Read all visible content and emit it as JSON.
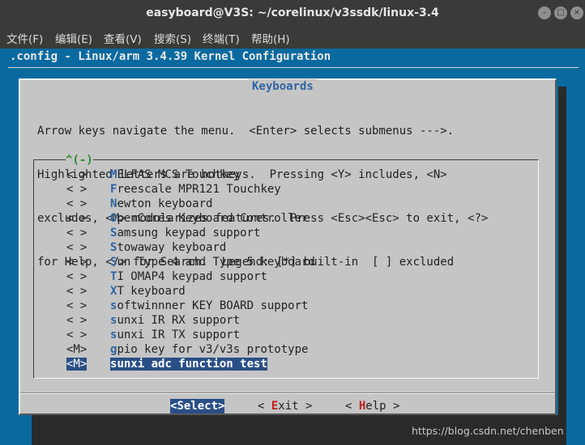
{
  "window": {
    "title": "easyboard@V3S: ~/corelinux/v3ssdk/linux-3.4",
    "buttons": {
      "minimize": "–",
      "maximize": "□",
      "close": "×"
    }
  },
  "menubar": [
    "文件(F)",
    "编辑(E)",
    "查看(V)",
    "搜索(S)",
    "终端(T)",
    "帮助(H)"
  ],
  "terminal": {
    "header": ".config - Linux/arm 3.4.39 Kernel Configuration",
    "dialog": {
      "title": "Keyboards",
      "help_lines": [
        "Arrow keys navigate the menu.  <Enter> selects submenus --->.",
        "Highlighted letters are hotkeys.  Pressing <Y> includes, <N>",
        "excludes, <M> modularizes features.  Press <Esc><Esc> to exit, <?>",
        "for Help, </> for Search.  Legend: [*] built-in  [ ] excluded"
      ],
      "scroll_indicator": "^(-)",
      "items": [
        {
          "mark": "< >",
          "hotkey": "M",
          "rest": "ELFAS MCS Touchkey"
        },
        {
          "mark": "< >",
          "hotkey": "F",
          "rest": "reescale MPR121 Touchkey"
        },
        {
          "mark": "< >",
          "hotkey": "N",
          "rest": "ewton keyboard"
        },
        {
          "mark": "< >",
          "hotkey": "O",
          "rest": "penCores Keyboard Controller"
        },
        {
          "mark": "< >",
          "hotkey": "S",
          "rest": "amsung keypad support"
        },
        {
          "mark": "< >",
          "hotkey": "S",
          "rest": "towaway keyboard"
        },
        {
          "mark": "< >",
          "hotkey": "S",
          "rest": "un Type 4 and Type 5 keyboard"
        },
        {
          "mark": "< >",
          "hotkey": "T",
          "rest": "I OMAP4 keypad support"
        },
        {
          "mark": "< >",
          "hotkey": "X",
          "rest": "T keyboard"
        },
        {
          "mark": "< >",
          "hotkey": "s",
          "rest": "oftwinnner KEY BOARD support"
        },
        {
          "mark": "< >",
          "hotkey": "s",
          "rest": "unxi IR RX support"
        },
        {
          "mark": "< >",
          "hotkey": "s",
          "rest": "unxi IR TX support"
        },
        {
          "mark": "<M>",
          "hotkey": "g",
          "rest": "pio key for v3/v3s prototype"
        },
        {
          "mark": "<M>",
          "hotkey": "s",
          "rest": "unxi adc function test"
        }
      ],
      "buttons": {
        "select": {
          "pre": "<",
          "key": "S",
          "post": "elect>"
        },
        "exit": {
          "pre": "< ",
          "key": "E",
          "post": "xit >"
        },
        "help": {
          "pre": "< ",
          "key": "H",
          "post": "elp >"
        }
      }
    }
  },
  "watermark": "https://blog.csdn.net/chenben"
}
